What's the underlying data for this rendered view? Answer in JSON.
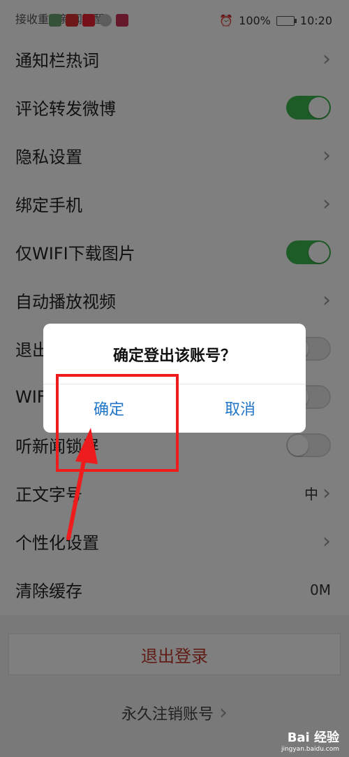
{
  "status_bar": {
    "notification_text": "接收重大新闻提醒",
    "battery": "100%",
    "time": "10:20"
  },
  "settings": [
    {
      "label": "通知栏热词",
      "control": "chevron"
    },
    {
      "label": "评论转发微博",
      "control": "toggle",
      "state": "on"
    },
    {
      "label": "隐私设置",
      "control": "chevron"
    },
    {
      "label": "绑定手机",
      "control": "chevron"
    },
    {
      "label": "仅WIFI下载图片",
      "control": "toggle",
      "state": "on"
    },
    {
      "label": "自动播放视频",
      "control": "chevron"
    },
    {
      "label": "退出",
      "control": "toggle",
      "state": "off"
    },
    {
      "label": "WIFI",
      "control": "toggle",
      "state": "off"
    },
    {
      "label": "听新闻锁屏",
      "control": "toggle",
      "state": "off"
    },
    {
      "label": "正文字号",
      "control": "value_chevron",
      "value": "中"
    },
    {
      "label": "个性化设置",
      "control": "chevron"
    },
    {
      "label": "清除缓存",
      "control": "value",
      "value": "0M"
    }
  ],
  "logout_button": "退出登录",
  "cancel_account": "永久注销账号",
  "dialog": {
    "title": "确定登出该账号？",
    "confirm": "确定",
    "cancel": "取消"
  },
  "watermark": {
    "brand": "Bai 经验",
    "url": "jingyan.baidu.com"
  },
  "colors": {
    "toggle_on": "#3cb94f",
    "dialog_button": "#2176c7",
    "logout_text": "#c0392b",
    "highlight": "#ee1c1c"
  }
}
